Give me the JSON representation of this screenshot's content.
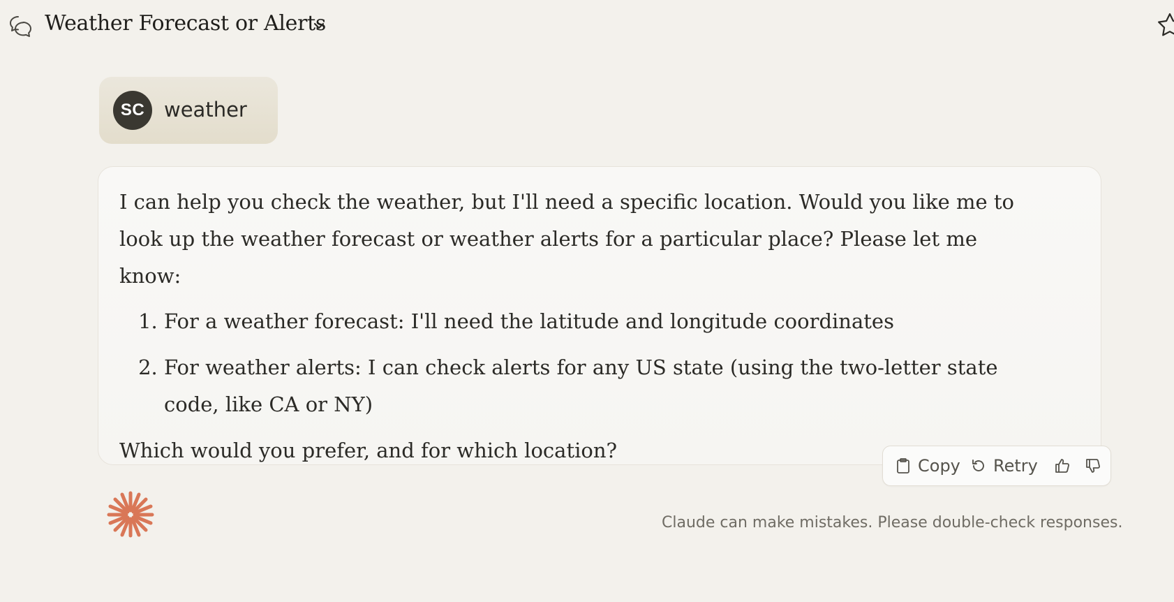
{
  "header": {
    "title": "Weather Forecast or Alerts",
    "icons": {
      "conversation": "chat-bubbles-icon",
      "dropdown": "chevron-down-icon",
      "favorite": "star-icon"
    }
  },
  "user_message": {
    "avatar_initials": "SC",
    "text": "weather"
  },
  "assistant_message": {
    "intro": "I can help you check the weather, but I'll need a specific location. Would you like me to look up the weather forecast or weather alerts for a particular place? Please let me know:",
    "options": [
      "For a weather forecast: I'll need the latitude and longitude coordinates",
      "For weather alerts: I can check alerts for any US state (using the two-letter state code, like CA or NY)"
    ],
    "closing": "Which would you prefer, and for which location?"
  },
  "actions": {
    "copy_label": "Copy",
    "retry_label": "Retry",
    "icons": {
      "copy": "clipboard-icon",
      "retry": "retry-icon",
      "thumbs_up": "thumbs-up-icon",
      "thumbs_down": "thumbs-down-icon"
    }
  },
  "footer": {
    "disclaimer": "Claude can make mistakes. Please double-check responses."
  },
  "colors": {
    "background": "#f3f1ec",
    "user_bubble": "#e6e1d3",
    "avatar": "#3a3831",
    "claude_accent": "#d97757",
    "text": "#2b2a26"
  }
}
